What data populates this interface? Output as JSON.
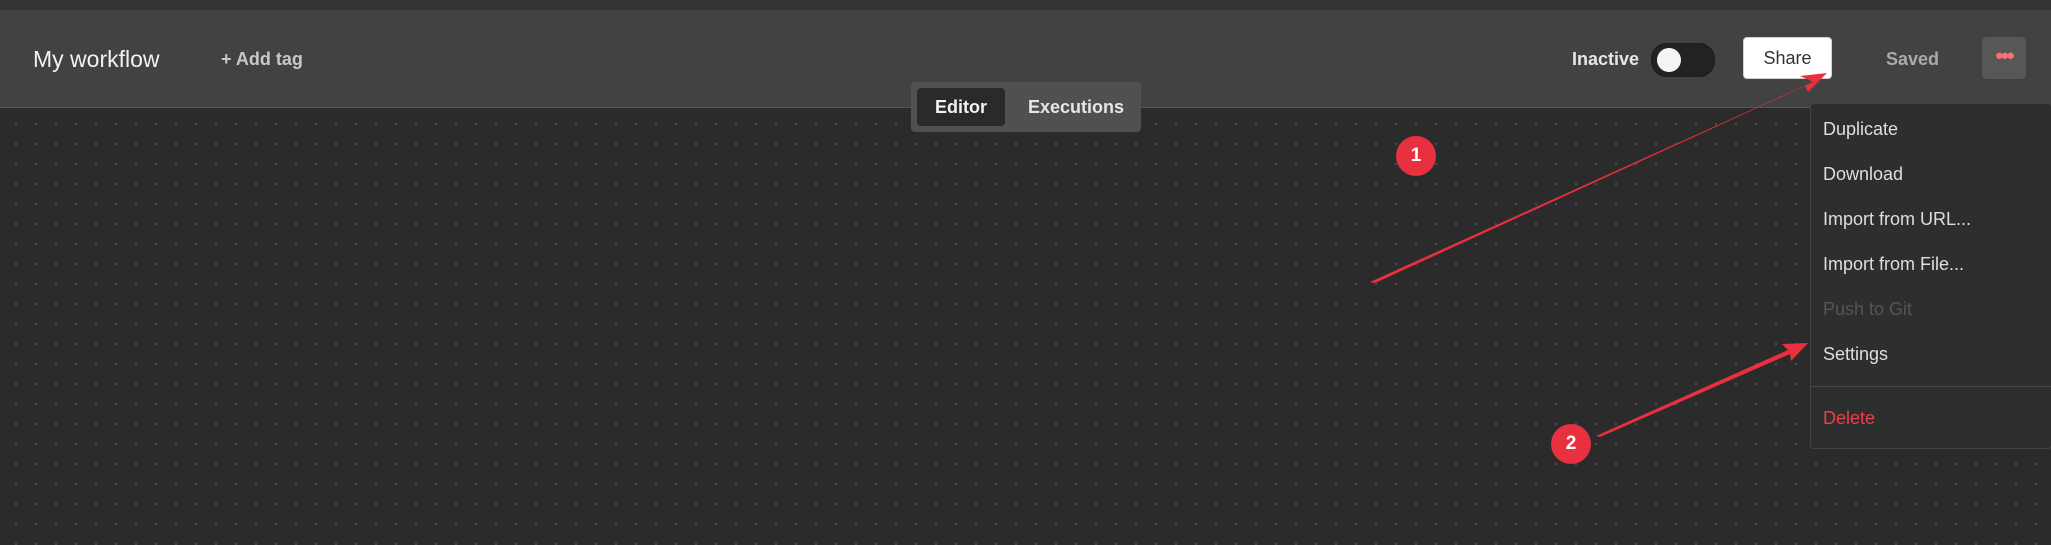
{
  "header": {
    "title": "My workflow",
    "add_tag_label": "+ Add tag",
    "status_label": "Inactive",
    "share_label": "Share",
    "saved_label": "Saved",
    "more_icon": "more-horizontal-icon"
  },
  "tabs": [
    {
      "label": "Editor",
      "active": true
    },
    {
      "label": "Executions",
      "active": false
    }
  ],
  "menu": {
    "items": [
      {
        "label": "Duplicate",
        "state": "enabled"
      },
      {
        "label": "Download",
        "state": "enabled"
      },
      {
        "label": "Import from URL...",
        "state": "enabled"
      },
      {
        "label": "Import from File...",
        "state": "enabled"
      },
      {
        "label": "Push to Git",
        "state": "disabled"
      },
      {
        "label": "Settings",
        "state": "enabled"
      }
    ],
    "danger_item": {
      "label": "Delete"
    }
  },
  "annotations": [
    {
      "label": "1"
    },
    {
      "label": "2"
    }
  ],
  "colors": {
    "accent": "#ff6d75",
    "danger": "#f03e48",
    "annotation": "#e8303e",
    "header_bg": "#424242",
    "canvas_bg": "#2b2b2b"
  }
}
